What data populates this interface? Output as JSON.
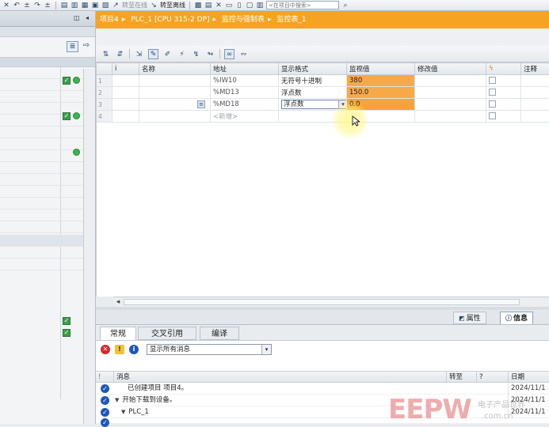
{
  "toolbar": {
    "go_online": "转至在线",
    "go_offline": "转至离线",
    "search_placeholder": "<在项目中搜索>"
  },
  "breadcrumb": [
    "项目4",
    "PLC_1 [CPU 315-2 DP]",
    "监控与强制表",
    "监控表_1"
  ],
  "watch_table": {
    "columns": [
      "i",
      "名称",
      "地址",
      "显示格式",
      "监视值",
      "修改值",
      "",
      "注释"
    ],
    "rows": [
      {
        "num": "1",
        "address": "%IW10",
        "format": "无符号十进制",
        "monitor": "380"
      },
      {
        "num": "2",
        "address": "%MD13",
        "format": "浮点数",
        "monitor": "150.0"
      },
      {
        "num": "3",
        "address": "%MD18",
        "format": "浮点数",
        "monitor": "0.0"
      },
      {
        "num": "4",
        "address": "<新增>",
        "format": "",
        "monitor": ""
      }
    ]
  },
  "inspector": {
    "tab_properties": "属性",
    "tab_info": "信息"
  },
  "info": {
    "subtabs": [
      "常规",
      "交叉引用",
      "编译"
    ],
    "filter": "显示所有消息",
    "columns": {
      "msg": "消息",
      "goto": "转至",
      "q": "?",
      "date": "日期"
    },
    "messages": [
      {
        "text": "已创建项目 项目4。",
        "date": "2024/11/1"
      },
      {
        "text": "开始下载到设备。",
        "date": "2024/11/1"
      },
      {
        "text": "PLC_1",
        "date": "2024/11/1"
      }
    ]
  },
  "logo": {
    "text": "EEPW",
    "tagline": "电子产品世界"
  },
  "colors": {
    "accent": "#f5a321",
    "monitor_cell": "#f7a94a",
    "ok_check": "#3aa04a",
    "info_icon": "#1f57b8"
  }
}
